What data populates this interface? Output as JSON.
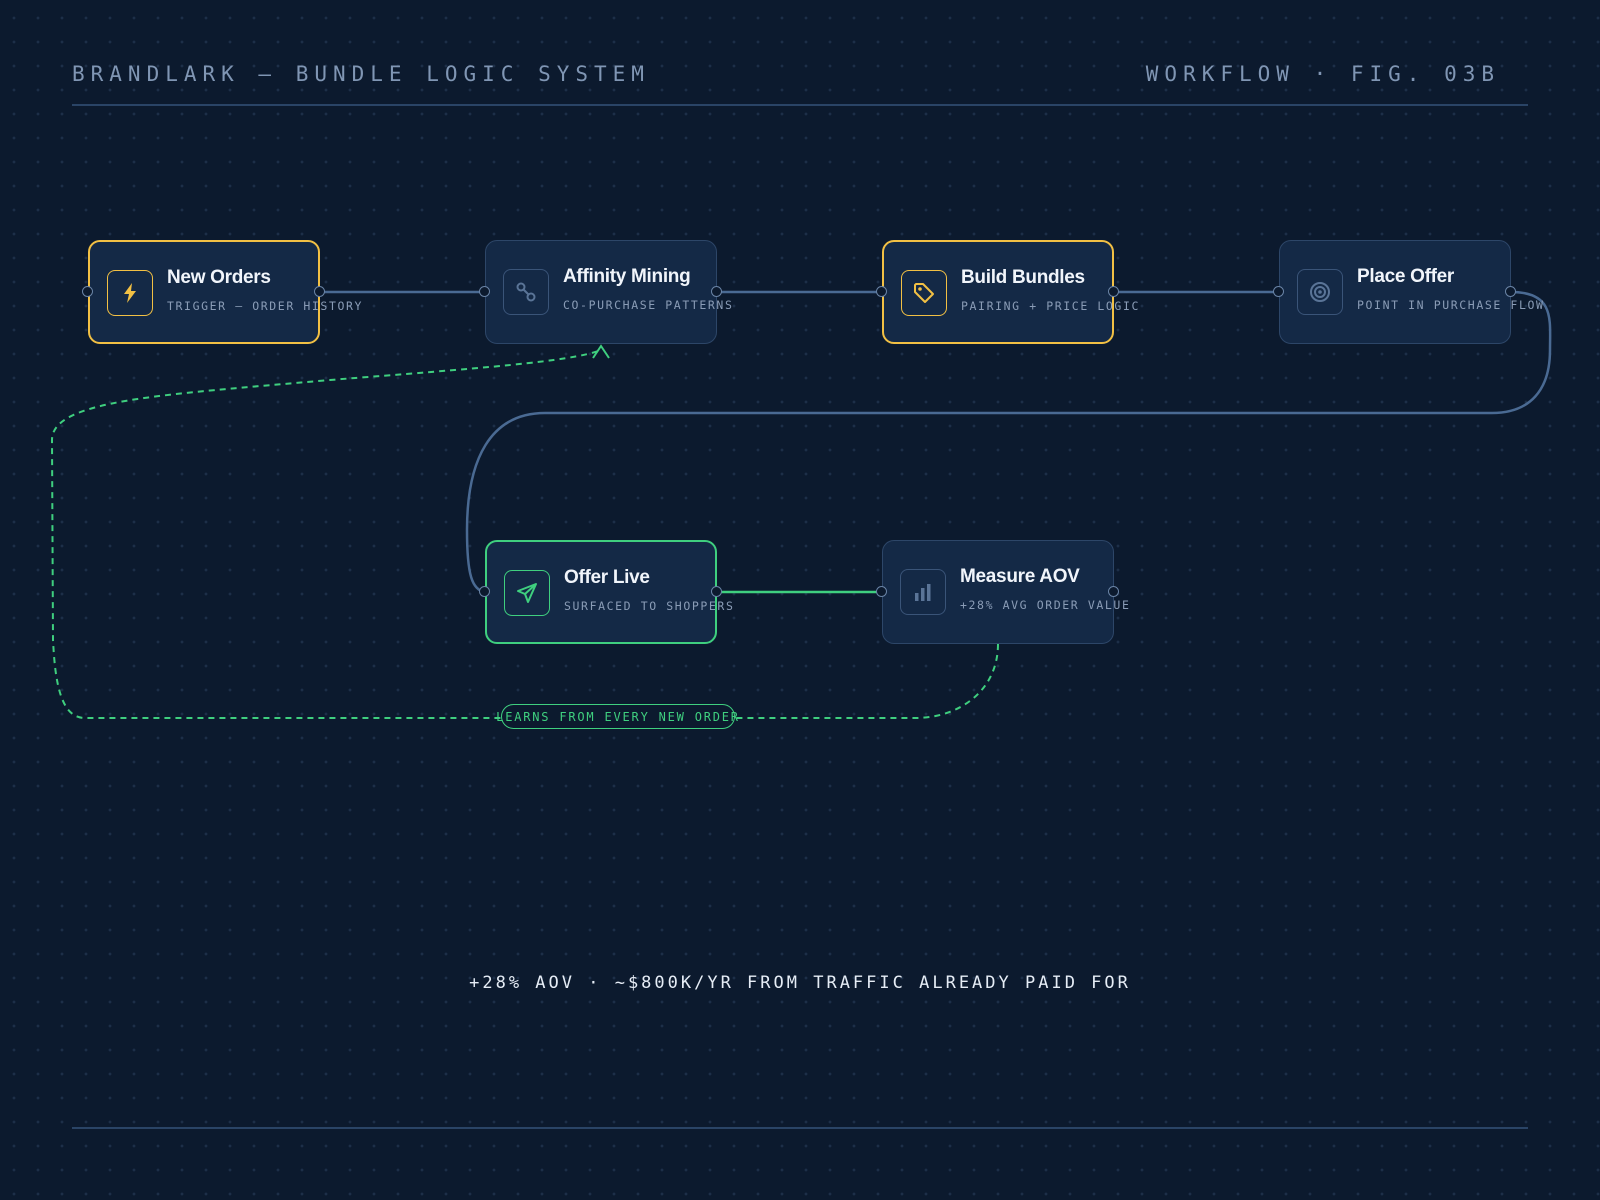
{
  "header": {
    "left": "BRANDLARK — BUNDLE LOGIC SYSTEM",
    "right": "WORKFLOW · FIG. 03B"
  },
  "nodes": [
    {
      "id": "new-orders",
      "title": "New Orders",
      "subtitle": "TRIGGER — ORDER HISTORY",
      "icon": "lightning-icon",
      "accent": "#f2c044"
    },
    {
      "id": "affinity-mining",
      "title": "Affinity Mining",
      "subtitle": "CO-PURCHASE PATTERNS",
      "icon": "link-nodes-icon"
    },
    {
      "id": "build-bundles",
      "title": "Build Bundles",
      "subtitle": "PAIRING + PRICE LOGIC",
      "icon": "tag-icon",
      "accent": "#f2c044"
    },
    {
      "id": "place-offer",
      "title": "Place Offer",
      "subtitle": "POINT IN PURCHASE FLOW",
      "icon": "target-icon"
    },
    {
      "id": "offer-live",
      "title": "Offer Live",
      "subtitle": "SURFACED TO SHOPPERS",
      "icon": "send-icon",
      "accent": "#3fcf7f"
    },
    {
      "id": "measure-aov",
      "title": "Measure AOV",
      "subtitle": "+28% AVG ORDER VALUE",
      "icon": "bar-chart-icon"
    }
  ],
  "feedback_loop": {
    "label": "LEARNS FROM EVERY NEW ORDER",
    "color": "#3fcf7f"
  },
  "footer": {
    "summary": "+28% AOV · ~$800K/YR FROM TRAFFIC ALREADY PAID FOR"
  },
  "colors": {
    "background": "#0c1a2e",
    "node_fill": "#142946",
    "connector": "#4a6a93",
    "gold_accent": "#f2c044",
    "green_accent": "#3fcf7f"
  }
}
